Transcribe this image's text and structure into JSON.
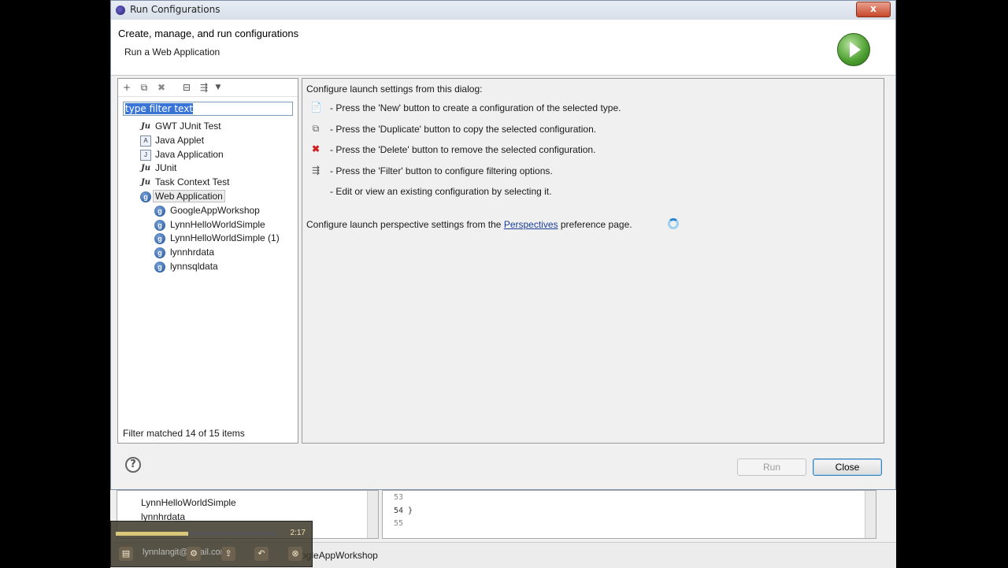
{
  "window": {
    "title": "Run Configurations",
    "close_label": "x"
  },
  "header": {
    "heading": "Create, manage, and run configurations",
    "subheading": "Run a Web Application"
  },
  "left_pane": {
    "toolbar": [
      {
        "name": "new-config-icon",
        "glyph": "📄"
      },
      {
        "name": "duplicate-icon",
        "glyph": "⧉"
      },
      {
        "name": "delete-icon",
        "glyph": "✖"
      },
      {
        "name": "collapse-all-icon",
        "glyph": "⊟"
      },
      {
        "name": "filter-icon",
        "glyph": "⇶"
      },
      {
        "name": "dropdown-arrow-icon",
        "glyph": "▾"
      }
    ],
    "filter_text": "type filter text",
    "tree": [
      {
        "label": "GWT JUnit Test",
        "icon": "Ju",
        "level": 1
      },
      {
        "label": "Java Applet",
        "icon": "A",
        "level": 1
      },
      {
        "label": "Java Application",
        "icon": "J",
        "level": 1
      },
      {
        "label": "JUnit",
        "icon": "Ju",
        "level": 1
      },
      {
        "label": "Task Context Test",
        "icon": "Ju",
        "level": 1
      },
      {
        "label": "Web Application",
        "icon": "g",
        "level": 1,
        "selected": true
      },
      {
        "label": "GoogleAppWorkshop",
        "icon": "g",
        "level": 2
      },
      {
        "label": "LynnHelloWorldSimple",
        "icon": "g",
        "level": 2
      },
      {
        "label": "LynnHelloWorldSimple (1)",
        "icon": "g",
        "level": 2
      },
      {
        "label": "lynnhrdata",
        "icon": "g",
        "level": 2
      },
      {
        "label": "lynnsqldata",
        "icon": "g",
        "level": 2
      }
    ],
    "status": "Filter matched 14 of 15 items"
  },
  "right_pane": {
    "intro": "Configure launch settings from this dialog:",
    "items": [
      {
        "icon": "new-icon",
        "glyph": "📄",
        "text": "- Press the 'New' button to create a configuration of the selected type."
      },
      {
        "icon": "duplicate-icon",
        "glyph": "⧉",
        "text": "- Press the 'Duplicate' button to copy the selected configuration."
      },
      {
        "icon": "delete-icon",
        "glyph": "✖",
        "text": "- Press the 'Delete' button to remove the selected configuration."
      },
      {
        "icon": "filter-icon",
        "glyph": "⇶",
        "text": "- Press the 'Filter' button to configure filtering options."
      },
      {
        "icon": "",
        "glyph": "",
        "text": "- Edit or view an existing configuration by selecting it."
      }
    ],
    "perspective_prefix": "Configure launch perspective settings from the ",
    "perspective_link": "Perspectives",
    "perspective_suffix": " preference page."
  },
  "buttons": {
    "help": "?",
    "run": "Run",
    "close": "Close"
  },
  "background": {
    "explorer_items": [
      "LynnHelloWorldSimple",
      "lynnhrdata"
    ],
    "editor_lines": [
      "53",
      "54   }",
      "55"
    ],
    "status_text": "ogleAppWorkshop",
    "email_text": "lynnlangit@gmail.com"
  },
  "video": {
    "time": "2:17",
    "progress": 0.45
  }
}
